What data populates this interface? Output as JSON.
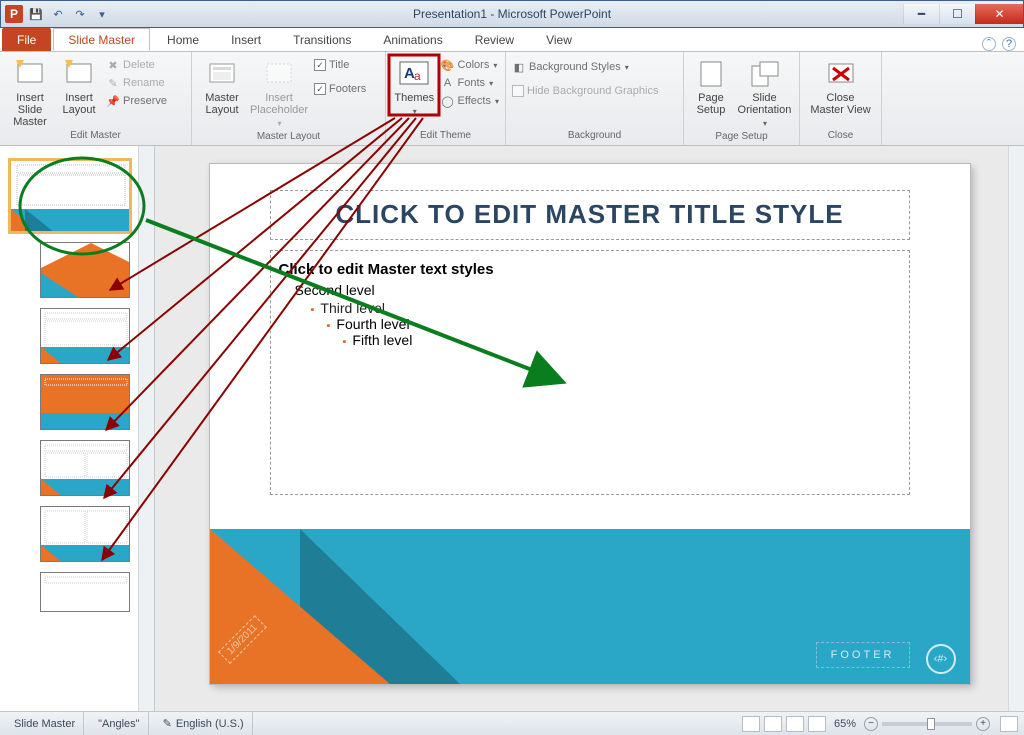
{
  "window": {
    "title": "Presentation1 - Microsoft PowerPoint"
  },
  "tabs": {
    "file": "File",
    "items": [
      "Slide Master",
      "Home",
      "Insert",
      "Transitions",
      "Animations",
      "Review",
      "View"
    ],
    "active": "Slide Master"
  },
  "ribbon": {
    "groups": {
      "edit_master": {
        "label": "Edit Master",
        "insert_slide_master": "Insert Slide\nMaster",
        "insert_layout": "Insert\nLayout",
        "delete": "Delete",
        "rename": "Rename",
        "preserve": "Preserve"
      },
      "master_layout": {
        "label": "Master Layout",
        "master_layout_btn": "Master\nLayout",
        "insert_placeholder": "Insert\nPlaceholder",
        "title": "Title",
        "footers": "Footers"
      },
      "edit_theme": {
        "label": "Edit Theme",
        "themes": "Themes",
        "colors": "Colors",
        "fonts": "Fonts",
        "effects": "Effects"
      },
      "background": {
        "label": "Background",
        "styles": "Background Styles",
        "hide": "Hide Background Graphics"
      },
      "page_setup": {
        "label": "Page Setup",
        "page_setup_btn": "Page\nSetup",
        "orientation": "Slide\nOrientation"
      },
      "close": {
        "label": "Close",
        "close_btn": "Close\nMaster View"
      }
    }
  },
  "slide": {
    "title": "CLICK TO EDIT MASTER TITLE STYLE",
    "l1": "Click to edit Master text styles",
    "l2": "Second level",
    "l3": "Third level",
    "l4": "Fourth level",
    "l5": "Fifth level",
    "footer": "FOOTER",
    "date": "1/9/2011",
    "pagenum": "‹#›"
  },
  "status": {
    "view": "Slide Master",
    "theme": "\"Angles\"",
    "language": "English (U.S.)",
    "zoom": "65%"
  },
  "colors": {
    "accent_orange": "#e87226",
    "accent_cyan": "#2aa6c6",
    "accent_teal": "#1f7d96",
    "tutorial_red": "#b10000",
    "tutorial_green": "#0a7d1f"
  }
}
